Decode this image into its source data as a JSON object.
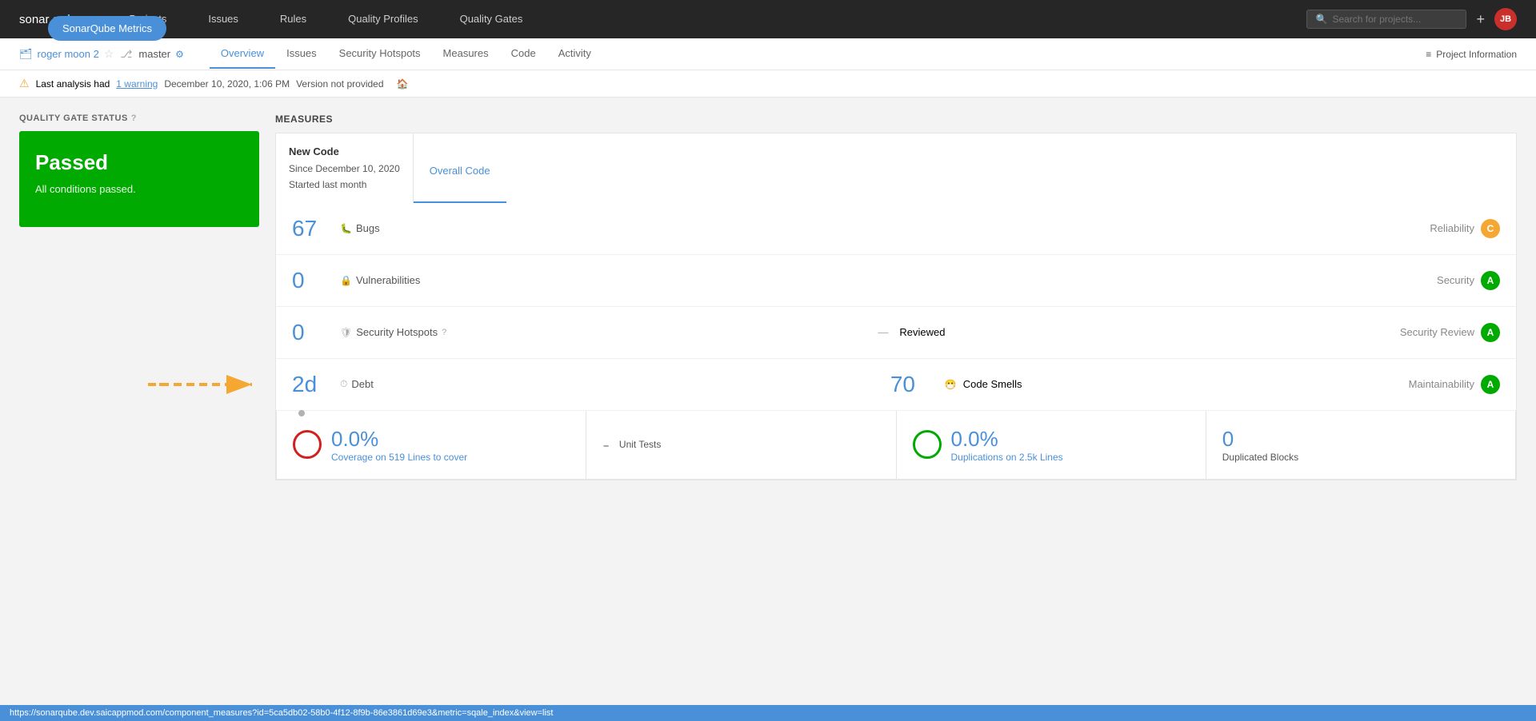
{
  "floating_btn": {
    "label": "SonarQube Metrics"
  },
  "topbar": {
    "logo_sonar": "sonarqube",
    "nav_items": [
      "Projects",
      "Issues",
      "Rules",
      "Quality Profiles",
      "Quality Gates"
    ],
    "search_placeholder": "Search for projects...",
    "plus": "+",
    "avatar": "JB"
  },
  "subnav": {
    "project_icon": "🗂",
    "project_name": "roger moon 2",
    "star": "☆",
    "branch_icon": "⎇",
    "branch_name": "master",
    "settings_icon": "⚙",
    "tabs": [
      "Overview",
      "Issues",
      "Security Hotspots",
      "Measures",
      "Code",
      "Activity"
    ],
    "active_tab": "Overview",
    "project_info_icon": "≡",
    "project_info_label": "Project Information"
  },
  "warning_bar": {
    "icon": "⚠",
    "prefix": "Last analysis had",
    "link": "1 warning",
    "date": "December 10, 2020, 1:06 PM",
    "version": "Version not provided",
    "home_icon": "🏠"
  },
  "quality_gate": {
    "section_title": "QUALITY GATE STATUS",
    "help_icon": "?",
    "status": "Passed",
    "subtitle": "All conditions passed."
  },
  "measures": {
    "section_title": "MEASURES",
    "new_code_label": "New Code",
    "new_code_since": "Since December 10, 2020",
    "new_code_started": "Started last month",
    "overall_code_label": "Overall Code",
    "rows": [
      {
        "value": "67",
        "icon": "🐛",
        "label": "Bugs",
        "right_label": "Reliability",
        "grade": "C",
        "grade_class": "grade-c"
      },
      {
        "value": "0",
        "icon": "🔒",
        "label": "Vulnerabilities",
        "right_label": "Security",
        "grade": "A",
        "grade_class": "grade-a"
      },
      {
        "value": "0",
        "icon": "🛡",
        "label": "Security Hotspots",
        "help_icon": "?",
        "reviewed_dash": "—",
        "reviewed_label": "Reviewed",
        "right_label": "Security Review",
        "grade": "A",
        "grade_class": "grade-a"
      }
    ],
    "debt_row": {
      "value": "2d",
      "icon": "⏱",
      "label": "Debt",
      "code_smells_value": "70",
      "code_smells_icon": "😷",
      "code_smells_label": "Code Smells",
      "right_label": "Maintainability",
      "grade": "A",
      "grade_class": "grade-a"
    },
    "bottom": {
      "coverage_value": "0.0%",
      "coverage_label": "Coverage on",
      "coverage_lines": "519",
      "coverage_lines_suffix": "Lines to cover",
      "unit_tests_dash": "-",
      "unit_tests_label": "Unit Tests",
      "duplications_value": "0.0%",
      "duplications_label": "Duplications on",
      "duplications_lines": "2.5k",
      "duplications_lines_suffix": "Lines",
      "dup_blocks_value": "0",
      "dup_blocks_label": "Duplicated Blocks"
    }
  },
  "status_bar": {
    "url": "https://sonarqube.dev.saicappmod.com/component_measures?id=5ca5db02-58b0-4f12-8f9b-86e3861d69e3&metric=sqale_index&view=list"
  }
}
